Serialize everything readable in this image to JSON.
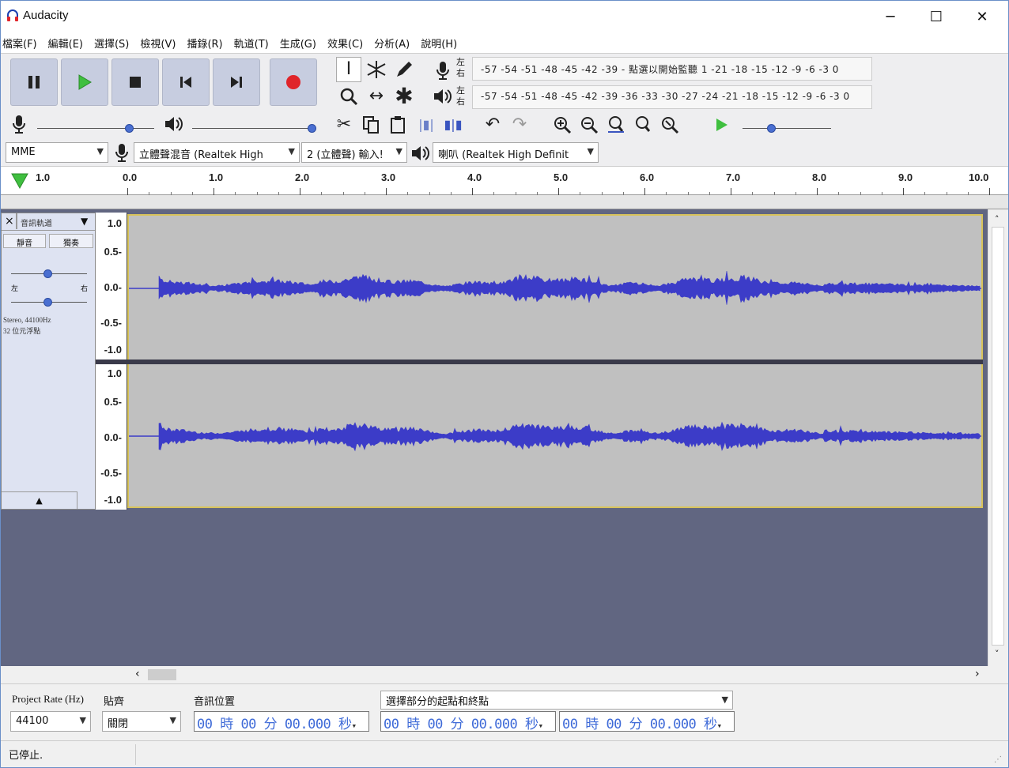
{
  "window": {
    "title": "Audacity",
    "minimize_glyph": "─",
    "maximize_glyph": "☐",
    "close_glyph": "✕"
  },
  "menu": [
    {
      "label": "檔案(F)"
    },
    {
      "label": "編輯(E)"
    },
    {
      "label": "選擇(S)"
    },
    {
      "label": "檢視(V)"
    },
    {
      "label": "播錄(R)"
    },
    {
      "label": "軌道(T)"
    },
    {
      "label": "生成(G)"
    },
    {
      "label": "效果(C)"
    },
    {
      "label": "分析(A)"
    },
    {
      "label": "說明(H)"
    }
  ],
  "meters": {
    "record_channel_label": "左右",
    "playback_channel_label": "左右",
    "record_ticks": "-57 -54 -51 -48 -45 -42 -39 - 點選以開始監聽 1 -21 -18 -15 -12 -9 -6 -3 0",
    "playback_ticks": "-57 -54 -51 -48 -45 -42 -39 -36 -33 -30 -27 -24 -21 -18 -15 -12 -9 -6 -3 0"
  },
  "device_toolbar": {
    "host": "MME",
    "recording_device": "立體聲混音 (Realtek High",
    "channels": "2 (立體聲) 輸入!",
    "playback_device": "喇叭 (Realtek High Definit"
  },
  "ruler": {
    "play_head_label": "1.0",
    "labels": [
      "0.0",
      "1.0",
      "2.0",
      "3.0",
      "4.0",
      "5.0",
      "6.0",
      "7.0",
      "8.0",
      "9.0",
      "10.0"
    ]
  },
  "track": {
    "name": "音訊軌道",
    "mute_label": "靜音",
    "solo_label": "獨奏",
    "pan_left": "左",
    "pan_right": "右",
    "info_line1": "Stereo, 44100Hz",
    "info_line2": "32 位元浮點",
    "collapse_glyph": "▲"
  },
  "vertical_ruler": {
    "channel1": [
      "1.0",
      "0.5-",
      "0.0-",
      "-0.5-",
      "-1.0"
    ],
    "channel2": [
      "1.0",
      "0.5-",
      "0.0-",
      "-0.5-",
      "-1.0"
    ]
  },
  "selection_toolbar": {
    "project_rate_label": "Project Rate (Hz)",
    "project_rate_value": "44100",
    "snap_label": "貼齊",
    "snap_value": "關閉",
    "audio_position_label": "音訊位置",
    "audio_position_value": "00 時 00 分 00.000 秒",
    "selection_mode_label": "選擇部分的起點和終點",
    "selection_start": "00 時 00 分 00.000 秒",
    "selection_end": "00 時 00 分 00.000 秒"
  },
  "status": {
    "text": "已停止."
  },
  "colors": {
    "waveform": "#3c3cc8",
    "waveform_bg": "#c0c0c0",
    "tracks_bg": "#616681",
    "selection_border": "#d8c35b",
    "record_button": "#e0242a",
    "play_button": "#3fbf3f",
    "time_digits": "#3f6bd8"
  }
}
